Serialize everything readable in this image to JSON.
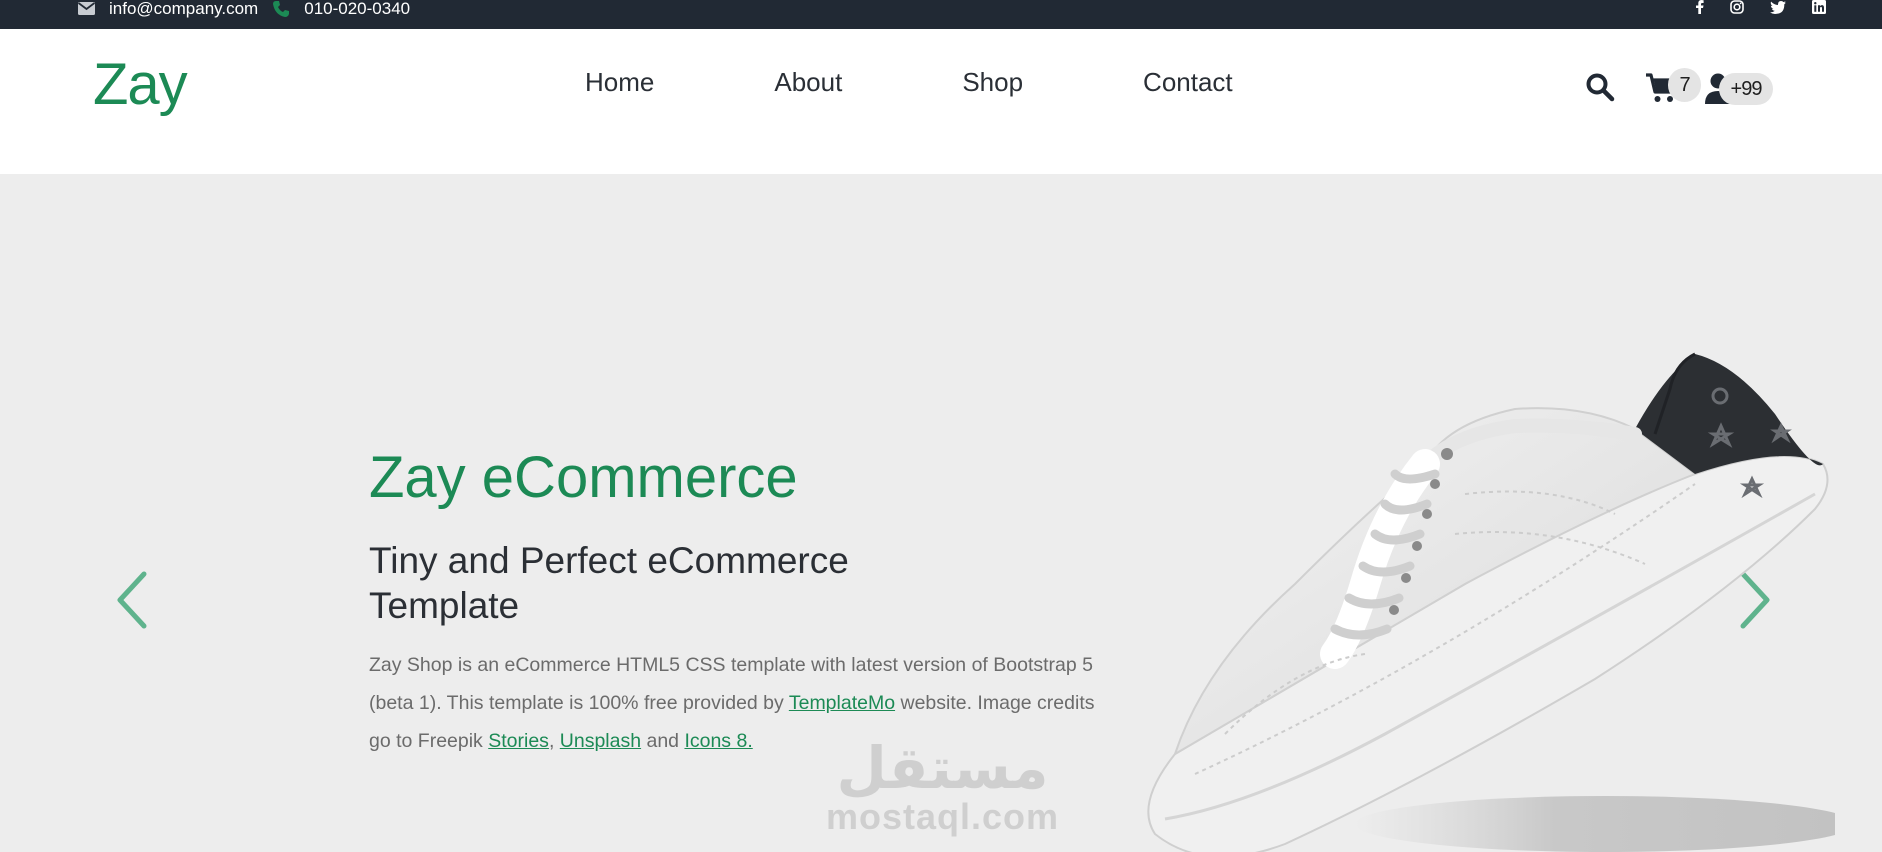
{
  "topbar": {
    "email": "info@company.com",
    "phone": "010-020-0340",
    "social_icons": [
      "facebook-icon",
      "instagram-icon",
      "twitter-icon",
      "linkedin-icon"
    ]
  },
  "header": {
    "logo": "Zay",
    "nav": [
      {
        "label": "Home"
      },
      {
        "label": "About"
      },
      {
        "label": "Shop"
      },
      {
        "label": "Contact"
      }
    ],
    "cart_badge": "7",
    "user_badge": "+99"
  },
  "hero": {
    "title_strong": "Zay",
    "title_rest": " eCommerce",
    "subtitle": "Tiny and Perfect eCommerce Template",
    "text_before": "Zay Shop is an eCommerce HTML5 CSS template with latest version of Bootstrap 5 (beta 1). This template is 100% free provided by ",
    "link_templatemo": "TemplateMo",
    "text_middle": " website. Image credits go to Freepik ",
    "link_stories": "Stories",
    "comma": ", ",
    "link_unsplash": "Unsplash",
    "and": " and ",
    "link_icons8": "Icons 8."
  },
  "watermark": {
    "arabic": "مستقل",
    "latin": "mostaql.com"
  },
  "colors": {
    "brand": "#1c8a55",
    "topbar": "#212934",
    "hero_bg": "#ededed"
  }
}
